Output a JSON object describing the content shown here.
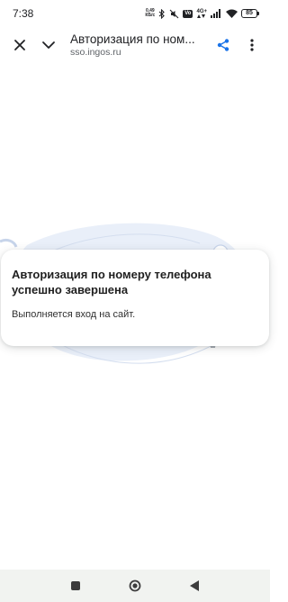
{
  "status_bar": {
    "time": "7:38",
    "net_speed_value": "0,49",
    "net_speed_unit": "КБ/с",
    "volte_label": "Vo",
    "network_label": "4G+",
    "battery_level": "85"
  },
  "toolbar": {
    "title": "Авторизация по ном...",
    "url": "sso.ingos.ru"
  },
  "card": {
    "title": "Авторизация по номеру телефона успешно завершена",
    "message": "Выполняется вход на сайт."
  },
  "colors": {
    "share_icon": "#1a73e8",
    "illustration_blue": "#dfe8f7",
    "nav_bar_bg": "#f1f3f0"
  },
  "icons": {
    "close": "close-icon",
    "collapse": "chevron-down-icon",
    "share": "share-icon",
    "menu": "more-vert-icon",
    "nav_recents": "square-icon",
    "nav_home": "circle-icon",
    "nav_back": "triangle-back-icon"
  }
}
